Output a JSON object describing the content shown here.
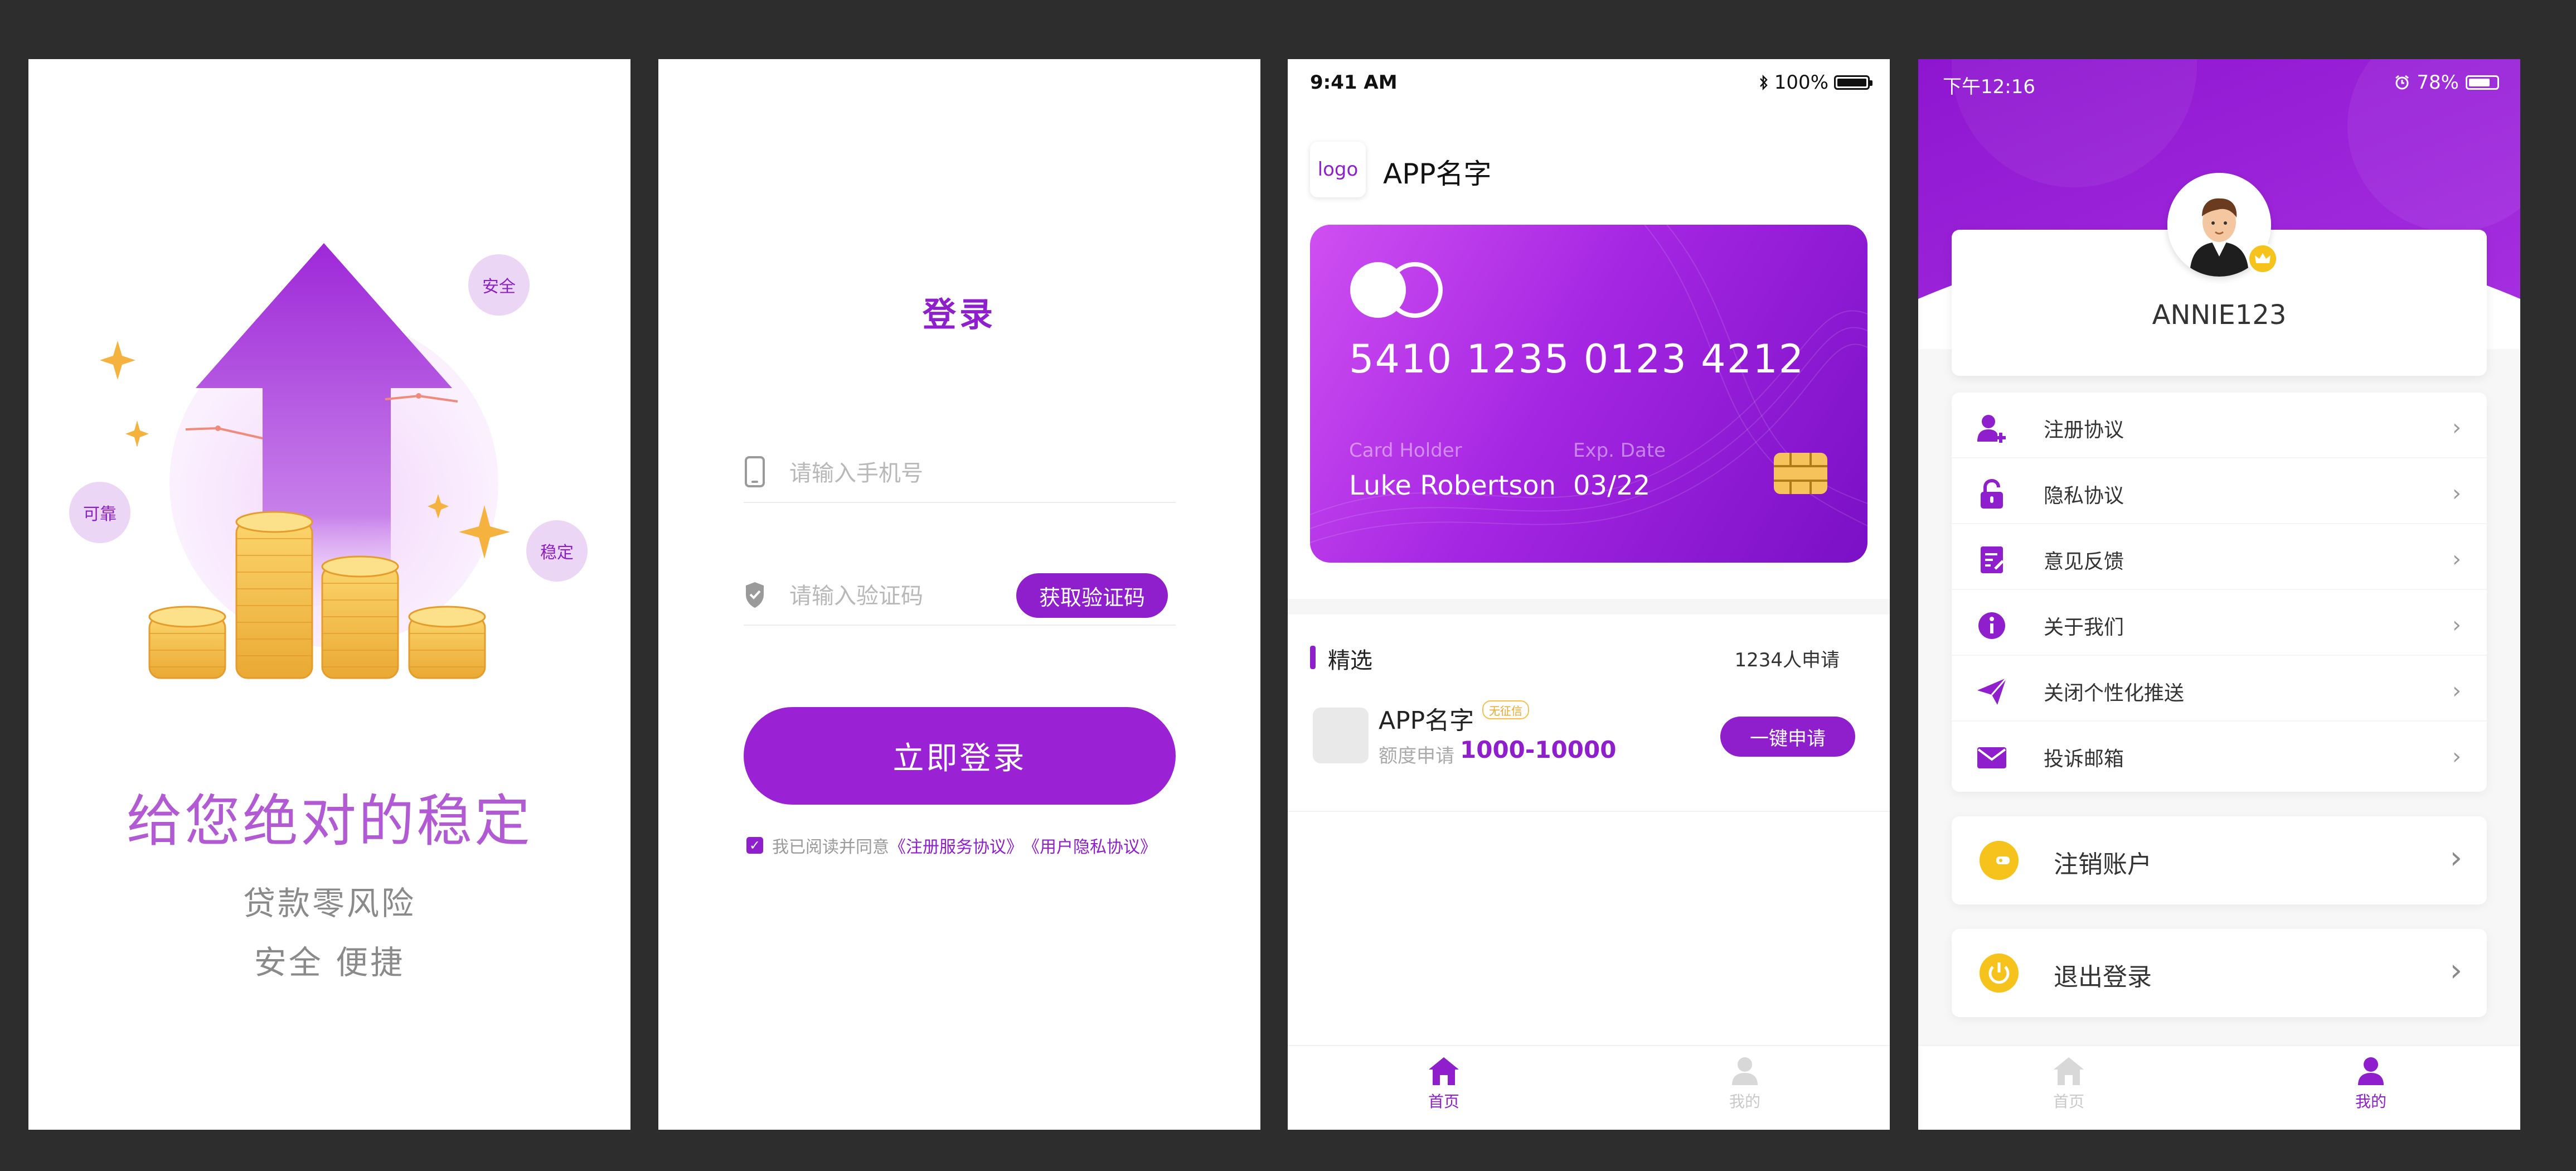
{
  "colors": {
    "brand": "#8f1fcc",
    "accent_gold": "#f5c31c",
    "bg": "#2d2d2d"
  },
  "splash": {
    "badges": {
      "safe": "安全",
      "reliable": "可靠",
      "stable": "稳定"
    },
    "title": "给您绝对的稳定",
    "line1": "贷款零风险",
    "line2": "安全 便捷"
  },
  "login": {
    "title": "登录",
    "phone_placeholder": "请输入手机号",
    "code_placeholder": "请输入验证码",
    "get_code": "获取验证码",
    "login_button": "立即登录",
    "agree_prefix": "我已阅读并同意",
    "agree_link1": "《注册服务协议》",
    "agree_link2": "《用户隐私协议》"
  },
  "home": {
    "status": {
      "time": "9:41 AM",
      "battery": "100%",
      "battery_level": 1.0
    },
    "logo_text": "logo",
    "app_name": "APP名字",
    "card": {
      "number": "5410 1235 0123 4212",
      "holder_label": "Card Holder",
      "holder": "Luke Robertson",
      "exp_label": "Exp. Date",
      "exp": "03/22"
    },
    "section": {
      "title": "精选",
      "count": "1234人申请"
    },
    "item": {
      "name": "APP名字",
      "tag": "无征信",
      "sub": "额度申请",
      "range": "1000-10000",
      "button": "一键申请"
    },
    "tabs": [
      {
        "label": "首页",
        "icon": "home-icon",
        "active": true
      },
      {
        "label": "我的",
        "icon": "user-icon",
        "active": false
      }
    ]
  },
  "profile": {
    "status": {
      "time": "下午12:16",
      "battery": "78%",
      "battery_level": 0.78
    },
    "username": "ANNIE123",
    "menu": [
      {
        "label": "注册协议",
        "icon": "user-add-icon"
      },
      {
        "label": "隐私协议",
        "icon": "lock-icon"
      },
      {
        "label": "意见反馈",
        "icon": "edit-note-icon"
      },
      {
        "label": "关于我们",
        "icon": "info-icon"
      },
      {
        "label": "关闭个性化推送",
        "icon": "paper-plane-icon"
      },
      {
        "label": "投诉邮箱",
        "icon": "mail-icon"
      }
    ],
    "cancel_account": "注销账户",
    "logout": "退出登录",
    "tabs": [
      {
        "label": "首页",
        "icon": "home-icon",
        "active": false
      },
      {
        "label": "我的",
        "icon": "user-icon",
        "active": true
      }
    ]
  }
}
